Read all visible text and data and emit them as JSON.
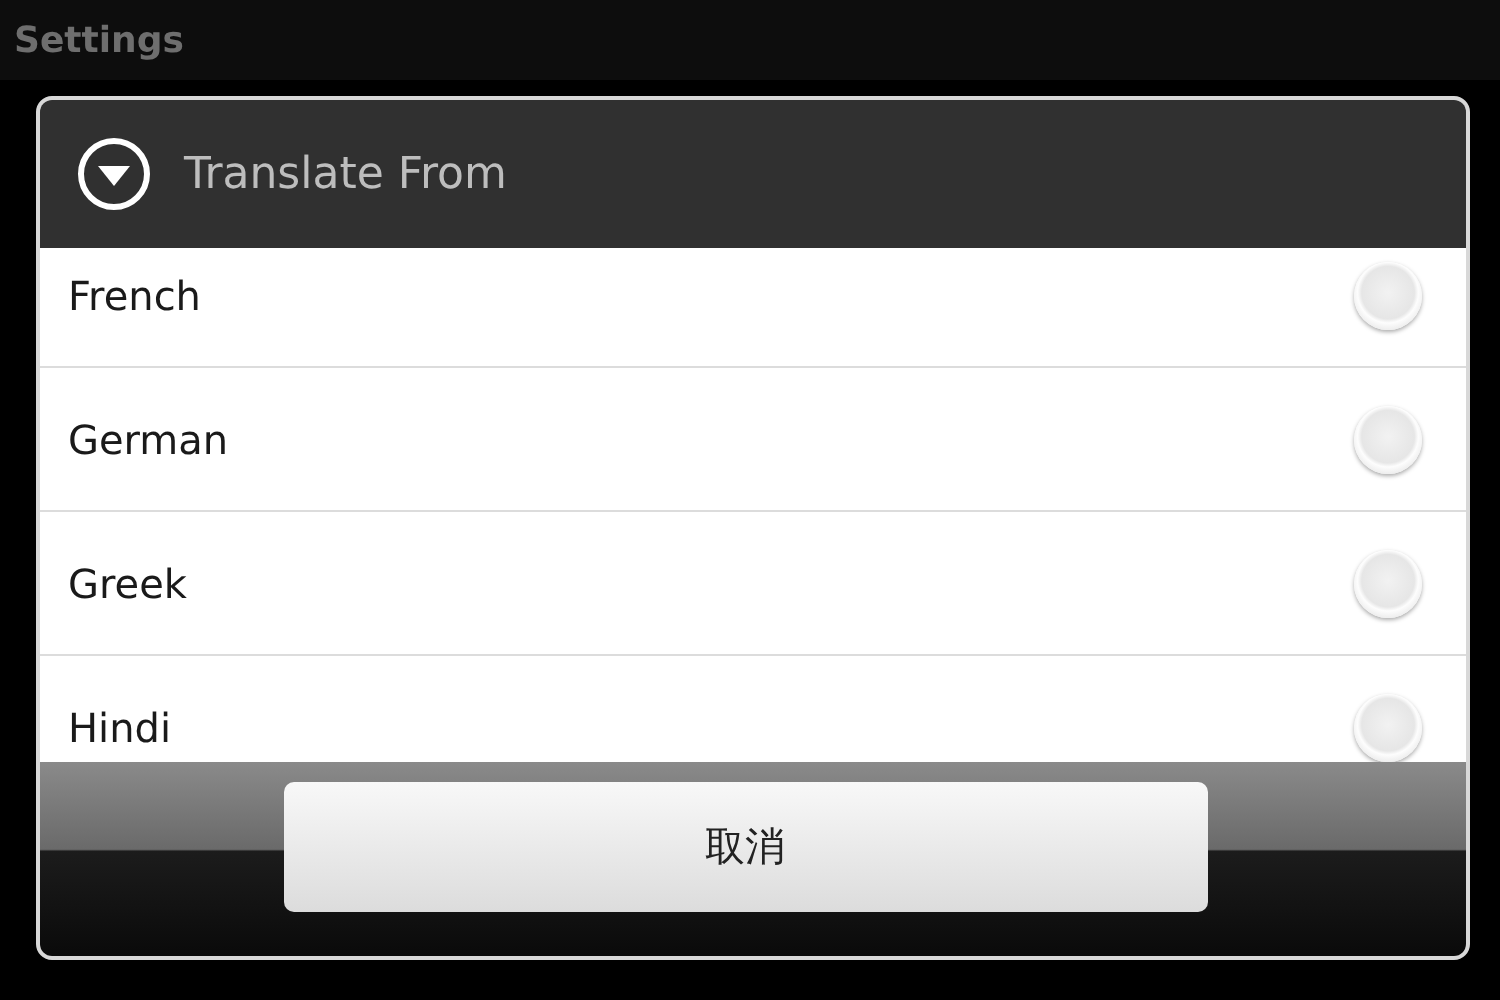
{
  "app_bar": {
    "title": "Settings"
  },
  "dialog": {
    "title": "Translate From",
    "options": [
      {
        "label": "French",
        "selected": false
      },
      {
        "label": "German",
        "selected": false
      },
      {
        "label": "Greek",
        "selected": false
      },
      {
        "label": "Hindi",
        "selected": false
      }
    ],
    "buttons": [
      "取消"
    ]
  }
}
